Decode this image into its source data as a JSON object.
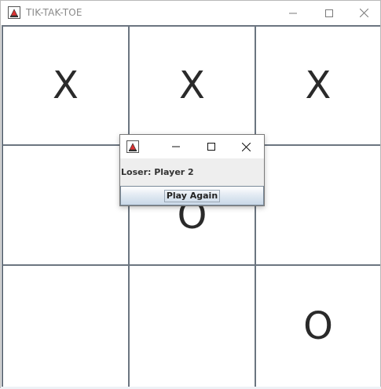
{
  "window": {
    "title": "TIK-TAK-TOE",
    "icon": "java-app-icon",
    "controls": [
      "minimize-icon",
      "maximize-icon",
      "close-icon"
    ]
  },
  "board": {
    "cells": [
      "X",
      "X",
      "X",
      "",
      "O",
      "",
      "",
      "",
      "O"
    ]
  },
  "dialog": {
    "icon": "java-app-icon",
    "message": "Loser: Player 2",
    "button_label": "Play Again"
  },
  "colors": {
    "grid_line": "#6b7580",
    "mark": "#2a2a2a",
    "dialog_bg": "#eeeeee"
  }
}
